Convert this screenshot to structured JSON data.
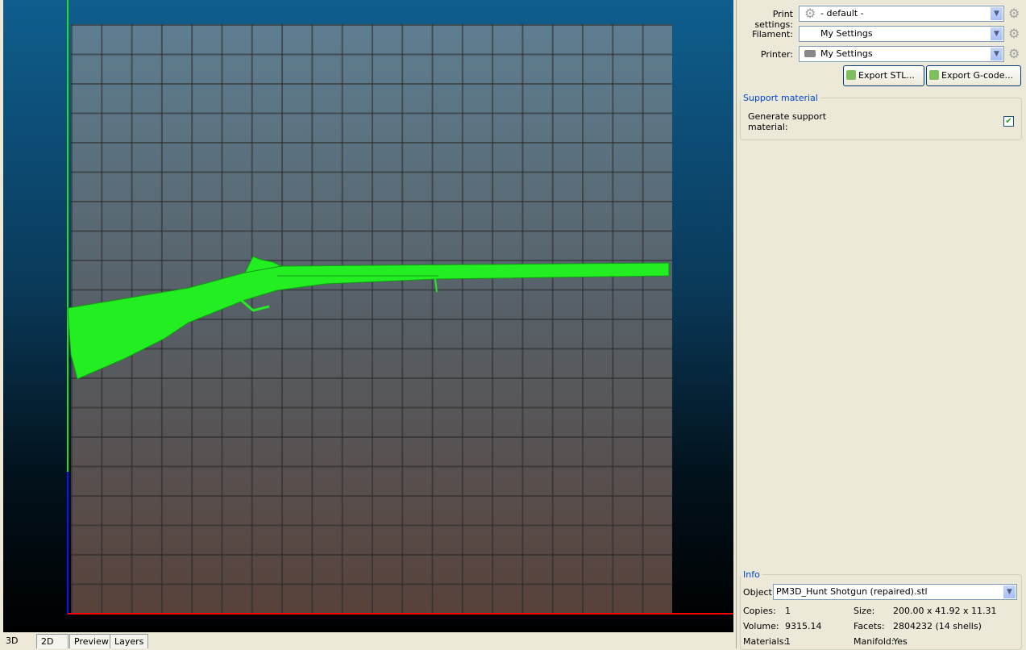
{
  "viewport": {
    "tabs": [
      {
        "label": "3D"
      },
      {
        "label": "2D"
      },
      {
        "label": "Preview"
      },
      {
        "label": "Layers"
      }
    ],
    "model_color": "#22ee22"
  },
  "settings": {
    "print_label": "Print settings:",
    "print_value": "- default -",
    "filament_label": "Filament:",
    "filament_value": "My Settings",
    "printer_label": "Printer:",
    "printer_value": "My Settings",
    "export_stl": "Export STL...",
    "export_gcode": "Export G-code..."
  },
  "support": {
    "title": "Support material",
    "generate_label": "Generate support material:",
    "generate_checked": true
  },
  "info": {
    "title": "Info",
    "object_label": "Object:",
    "object_value": "PM3D_Hunt Shotgun (repaired).stl",
    "copies_label": "Copies:",
    "copies": "1",
    "size_label": "Size:",
    "size": "200.00 x 41.92 x 11.31",
    "volume_label": "Volume:",
    "volume": "9315.14",
    "facets_label": "Facets:",
    "facets": "2804232 (14 shells)",
    "materials_label": "Materials:",
    "materials": "1",
    "manifold_label": "Manifold:",
    "manifold": "Yes"
  }
}
